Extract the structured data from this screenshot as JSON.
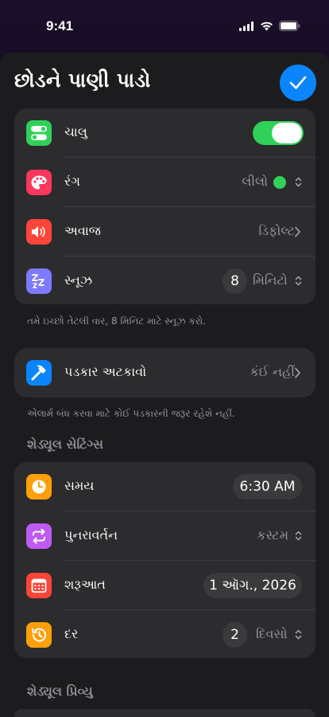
{
  "status_bar": {
    "time": "9:41"
  },
  "header": {
    "title": "છોડને પાણી પાડો"
  },
  "main_card": {
    "enabled": {
      "label": "ચાલુ",
      "on": true
    },
    "color": {
      "label": "રંગ",
      "value": "લીલો",
      "dot_color": "#30d158"
    },
    "sound": {
      "label": "અવાજ",
      "value": "ડિફોલ્ટ"
    },
    "snooze": {
      "label": "સ્નૂઝ",
      "number": "8",
      "unit": "મિનિટો"
    }
  },
  "snooze_note": "તમે ઇચ્છો તેટલી વાર, 8 મિનિટ માટે સ્નૂઝ કરો.",
  "challenge_card": {
    "label": "પડકાર અટકાવો",
    "value": "કંઈ નહીં"
  },
  "challenge_note": "એલાર્મ બંધ કરવા માટે કોઈ પડકારની જરૂર રહેશે નહીં.",
  "schedule_settings": {
    "header": "શેડ્યૂલ સેટિંગ્સ",
    "time": {
      "label": "સમય",
      "value": "6:30 AM"
    },
    "repeat": {
      "label": "પુનરાવર્તન",
      "value": "કસ્ટમ"
    },
    "start": {
      "label": "શરૂઆત",
      "value": "1 ઑગ., 2026"
    },
    "every": {
      "label": "દર",
      "number": "2",
      "unit": "દિવસો"
    }
  },
  "schedule_preview": {
    "header": "શેડ્યૂલ પ્રિવ્યુ"
  },
  "colors": {
    "accent": "#0a84ff",
    "toggle_on": "#30d158",
    "icon_toggle": "#30d158",
    "icon_color": "#ff375f",
    "icon_sound": "#ff453a",
    "icon_snooze": "#7d7aff",
    "icon_challenge": "#0a84ff",
    "icon_time": "#ff9f0a",
    "icon_repeat": "#bf5af2",
    "icon_start": "#ff453a",
    "icon_every": "#ff9f0a"
  },
  "icons": {
    "toggle": "toggle-switch-icon",
    "color": "palette-icon",
    "sound": "speaker-icon",
    "snooze": "zzz-icon",
    "challenge": "hammer-icon",
    "time": "clock-icon",
    "repeat": "repeat-icon",
    "start": "calendar-icon",
    "every": "history-icon"
  }
}
